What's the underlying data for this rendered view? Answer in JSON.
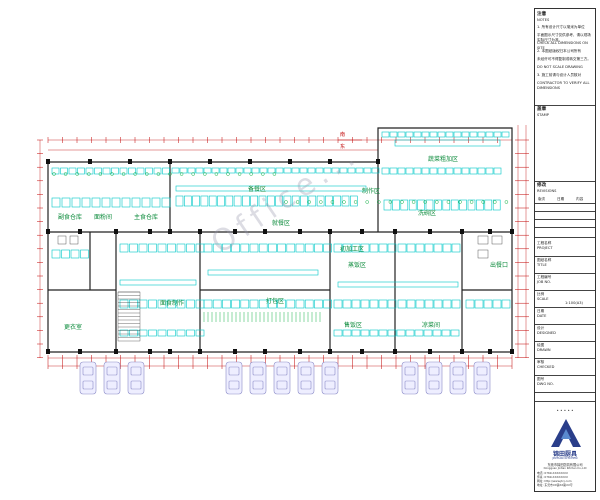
{
  "watermark": "Office...",
  "north": "东 → 南",
  "zones": [
    {
      "id": "shucai",
      "label": "蔬菜粗加区"
    },
    {
      "id": "caoq",
      "label": "备餐区"
    },
    {
      "id": "fushi",
      "label": "副食仓库"
    },
    {
      "id": "fanzao",
      "label": "面粉间"
    },
    {
      "id": "zhushi",
      "label": "主食仓库"
    },
    {
      "id": "xiwan",
      "label": "洗碗区"
    },
    {
      "id": "jiagong",
      "label": "初加工区"
    },
    {
      "id": "zhuocan",
      "label": "制作区"
    },
    {
      "id": "canting",
      "label": "就餐区"
    },
    {
      "id": "dabao",
      "label": "打包区"
    },
    {
      "id": "zhengfan",
      "label": "蒸饭区"
    },
    {
      "id": "mianshi",
      "label": "面食制作"
    },
    {
      "id": "shuchu",
      "label": "出餐口"
    },
    {
      "id": "gengyi",
      "label": "更衣室"
    },
    {
      "id": "dining2",
      "label": "售饭区"
    },
    {
      "id": "peican",
      "label": "凉菜间"
    }
  ],
  "title_block": {
    "notes_head": "注意",
    "notes_head_en": "NOTES",
    "notes": [
      "1. 所有设计尺寸以毫米为单位",
      "平面图示尺寸仅供参考，请以现场实际尺寸为准。",
      "CHECK ALL DIMENSIONS ON SITE",
      "2. 本图纸版权归本公司所有",
      "未经许可不得复制或转交第三方。",
      "DO NOT SCALE DRAWING",
      "3. 施工前请与设计人员核对",
      "CONTRACTOR TO VERIFY ALL DIMENSIONS"
    ],
    "stamp_head": "盖章",
    "stamp_head_en": "STAMP",
    "revision_head": "修改",
    "revision_head_en": "REVISIONS",
    "rev_cols": [
      "版次",
      "日期",
      "内容"
    ],
    "fields": [
      {
        "label": "工程名称",
        "en": "PROJECT"
      },
      {
        "label": "图纸名称",
        "en": "TITLE"
      },
      {
        "label": "工程编号",
        "en": "JOB NO."
      },
      {
        "label": "比例",
        "en": "SCALE",
        "value": "1:100(A3)"
      },
      {
        "label": "日期",
        "en": "DATE"
      },
      {
        "label": "设计",
        "en": "DESIGNED"
      },
      {
        "label": "绘图",
        "en": "DRAWN"
      },
      {
        "label": "审核",
        "en": "CHECKED"
      },
      {
        "label": "图号",
        "en": "DWG NO."
      }
    ],
    "scale_label": "1:100(A3)",
    "scale_bar": "• • • • •",
    "brand": "锦田厨具",
    "brand_sub": "JINTIAN KITCHEN",
    "company": "东莞市锦田厨具有限公司",
    "company_en": "Dongguan Jintian Kitchen Co.,Ltd",
    "contacts": [
      "电话: 0769-XXXXXXXX",
      "传真: 0769-XXXXXXXX",
      "网址: http://www.jtcj.com",
      "地址: 东莞市XX镇XX路XX号"
    ]
  },
  "colors": {
    "wall": "#222222",
    "equipment": "#00c8c8",
    "fixture": "#19b34a",
    "dimension": "#c00000",
    "label": "#0a8a3a",
    "column": "#111111",
    "vehicle": "#8c8cc8"
  }
}
